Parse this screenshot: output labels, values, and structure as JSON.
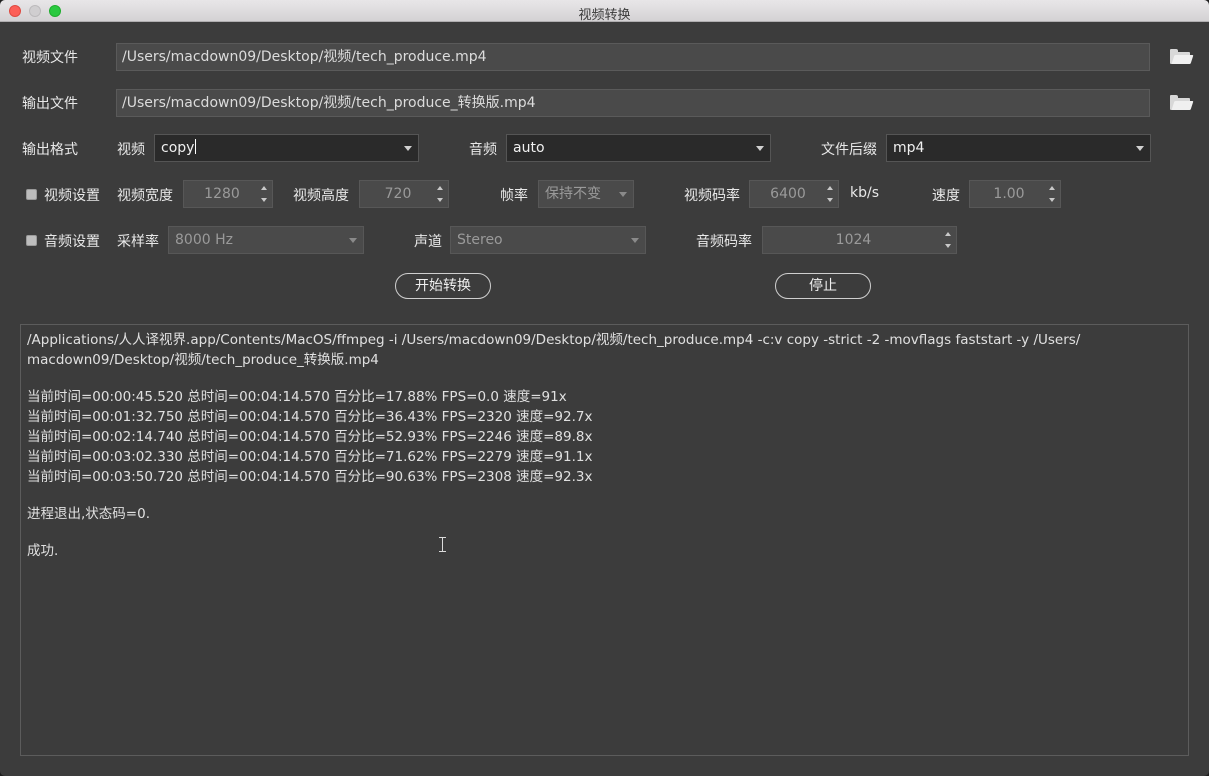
{
  "window": {
    "title": "视频转换"
  },
  "input_file": {
    "label": "视频文件",
    "value": "/Users/macdown09/Desktop/视频/tech_produce.mp4"
  },
  "output_file": {
    "label": "输出文件",
    "value": "/Users/macdown09/Desktop/视频/tech_produce_转换版.mp4"
  },
  "format": {
    "label": "输出格式",
    "video_label": "视频",
    "video_value": "copy",
    "audio_label": "音频",
    "audio_value": "auto",
    "suffix_label": "文件后缀",
    "suffix_value": "mp4"
  },
  "video_settings": {
    "checkbox_label": "视频设置",
    "width_label": "视频宽度",
    "width_value": "1280",
    "height_label": "视频高度",
    "height_value": "720",
    "fps_label": "帧率",
    "fps_value": "保持不变",
    "bitrate_label": "视频码率",
    "bitrate_value": "6400",
    "bitrate_unit": "kb/s",
    "speed_label": "速度",
    "speed_value": "1.00"
  },
  "audio_settings": {
    "checkbox_label": "音频设置",
    "rate_label": "采样率",
    "rate_value": "8000 Hz",
    "channel_label": "声道",
    "channel_value": "Stereo",
    "bitrate_label": "音频码率",
    "bitrate_value": "1024"
  },
  "actions": {
    "start": "开始转换",
    "stop": "停止"
  },
  "log": {
    "command_1": "/Applications/人人译视界.app/Contents/MacOS/ffmpeg -i /Users/macdown09/Desktop/视频/tech_produce.mp4 -c:v copy -strict -2 -movflags faststart -y /Users/",
    "command_2": "macdown09/Desktop/视频/tech_produce_转换版.mp4",
    "progress": [
      "当前时间=00:00:45.520 总时间=00:04:14.570 百分比=17.88% FPS=0.0 速度=91x",
      "当前时间=00:01:32.750 总时间=00:04:14.570 百分比=36.43% FPS=2320 速度=92.7x",
      "当前时间=00:02:14.740 总时间=00:04:14.570 百分比=52.93% FPS=2246 速度=89.8x",
      "当前时间=00:03:02.330 总时间=00:04:14.570 百分比=71.62% FPS=2279 速度=91.1x",
      "当前时间=00:03:50.720 总时间=00:04:14.570 百分比=90.63% FPS=2308 速度=92.3x"
    ],
    "exit": "进程退出,状态码=0.",
    "success": "成功."
  }
}
